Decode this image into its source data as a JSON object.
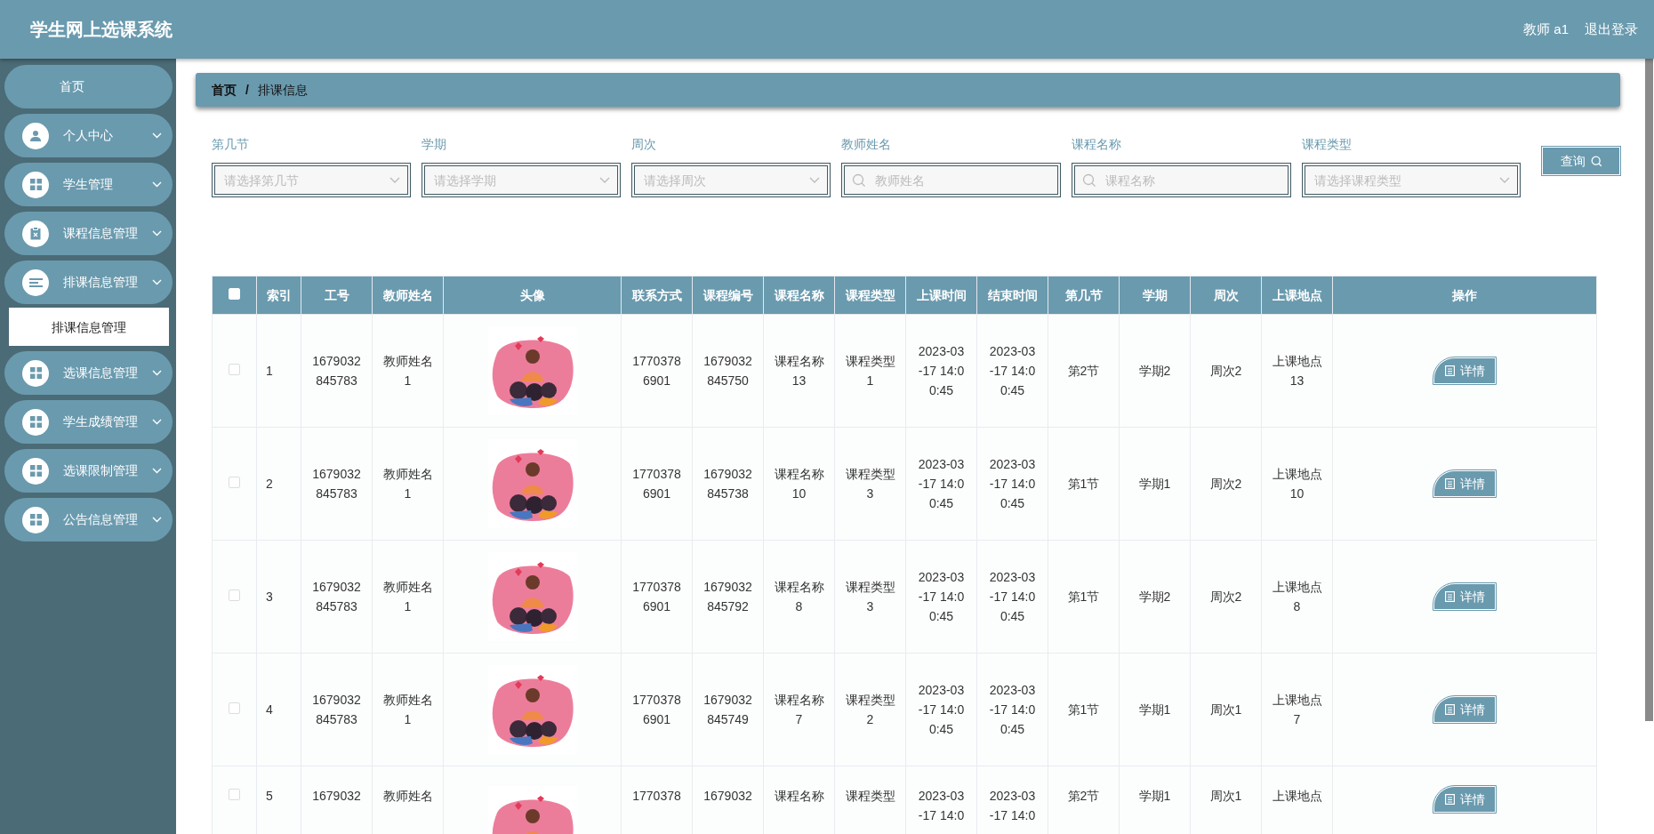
{
  "header": {
    "title": "学生网上选课系统",
    "user": "教师 a1",
    "logout": "退出登录"
  },
  "sidebar": {
    "items": [
      {
        "label": "首页",
        "kind": "plain"
      },
      {
        "label": "个人中心",
        "kind": "user"
      },
      {
        "label": "学生管理",
        "kind": "grid"
      },
      {
        "label": "课程信息管理",
        "kind": "clipboard"
      },
      {
        "label": "排课信息管理",
        "kind": "lines",
        "children": [
          {
            "label": "排课信息管理",
            "selected": true
          }
        ]
      },
      {
        "label": "选课信息管理",
        "kind": "grid"
      },
      {
        "label": "学生成绩管理",
        "kind": "grid"
      },
      {
        "label": "选课限制管理",
        "kind": "grid"
      },
      {
        "label": "公告信息管理",
        "kind": "grid"
      }
    ]
  },
  "breadcrumb": {
    "items": [
      "首页",
      "排课信息"
    ],
    "separator": "/"
  },
  "filters": [
    {
      "label": "第几节",
      "kind": "select",
      "placeholder": "请选择第几节"
    },
    {
      "label": "学期",
      "kind": "select",
      "placeholder": "请选择学期"
    },
    {
      "label": "周次",
      "kind": "select",
      "placeholder": "请选择周次"
    },
    {
      "label": "教师姓名",
      "kind": "search",
      "placeholder": "教师姓名"
    },
    {
      "label": "课程名称",
      "kind": "search",
      "placeholder": "课程名称"
    },
    {
      "label": "课程类型",
      "kind": "select",
      "placeholder": "请选择课程类型"
    }
  ],
  "query_button": "查询",
  "table": {
    "select_all_checked": false,
    "columns": [
      "索引",
      "工号",
      "教师姓名",
      "头像",
      "联系方式",
      "课程编号",
      "课程名称",
      "课程类型",
      "上课时间",
      "结束时间",
      "第几节",
      "学期",
      "周次",
      "上课地点",
      "操作"
    ],
    "rows": [
      {
        "checked": false,
        "cells": [
          "1",
          "1679032845783",
          "教师姓名1",
          "",
          "17703786901",
          "1679032845750",
          "课程名称13",
          "课程类型1",
          "2023-03-17 14:00:45",
          "2023-03-17 14:00:45",
          "第2节",
          "学期2",
          "周次2",
          "上课地点13"
        ],
        "action": "详情"
      },
      {
        "checked": false,
        "cells": [
          "2",
          "1679032845783",
          "教师姓名1",
          "",
          "17703786901",
          "1679032845738",
          "课程名称10",
          "课程类型3",
          "2023-03-17 14:00:45",
          "2023-03-17 14:00:45",
          "第1节",
          "学期1",
          "周次2",
          "上课地点10"
        ],
        "action": "详情"
      },
      {
        "checked": false,
        "cells": [
          "3",
          "1679032845783",
          "教师姓名1",
          "",
          "17703786901",
          "1679032845792",
          "课程名称8",
          "课程类型3",
          "2023-03-17 14:00:45",
          "2023-03-17 14:00:45",
          "第1节",
          "学期2",
          "周次2",
          "上课地点8"
        ],
        "action": "详情"
      },
      {
        "checked": false,
        "cells": [
          "4",
          "1679032845783",
          "教师姓名1",
          "",
          "17703786901",
          "1679032845749",
          "课程名称7",
          "课程类型2",
          "2023-03-17 14:00:45",
          "2023-03-17 14:00:45",
          "第1节",
          "学期1",
          "周次1",
          "上课地点7"
        ],
        "action": "详情"
      },
      {
        "checked": false,
        "cells": [
          "5",
          "1679032",
          "教师姓名",
          "",
          "1770378",
          "1679032",
          "课程名称",
          "课程类型",
          "2023-03-17 14:0",
          "2023-03-17 14:0",
          "第2节",
          "学期1",
          "周次1",
          "上课地点"
        ],
        "action": "详情"
      }
    ]
  }
}
